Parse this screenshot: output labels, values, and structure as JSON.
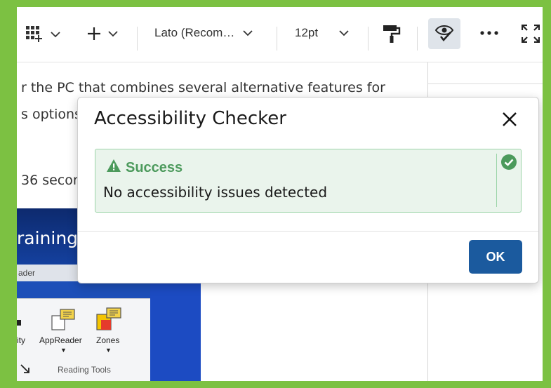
{
  "toolbar": {
    "font_name": "Lato (Recom…",
    "font_size": "12pt"
  },
  "document": {
    "line1": "r the PC that combines several alternative features for",
    "line2": "s options",
    "line3": "36 secon"
  },
  "embedded_image": {
    "title": "raining",
    "tab": "ader",
    "label_left": "ity",
    "label_appreader": "AppReader",
    "label_zones": "Zones",
    "group_label": "Reading Tools"
  },
  "dialog": {
    "title": "Accessibility Checker",
    "alert_heading": "Success",
    "alert_message": "No accessibility issues detected",
    "ok_label": "OK"
  },
  "colors": {
    "frame": "#7cc142",
    "success_text": "#4c9a5c",
    "success_bg": "#eaf4ec",
    "primary_button": "#1b5a9e"
  },
  "icons": [
    "table-icon",
    "plus-icon",
    "chevron-down-icon",
    "format-painter-icon",
    "eye-check-icon",
    "more-icon",
    "fullscreen-icon",
    "close-icon",
    "warning-icon",
    "check-circle-icon"
  ]
}
